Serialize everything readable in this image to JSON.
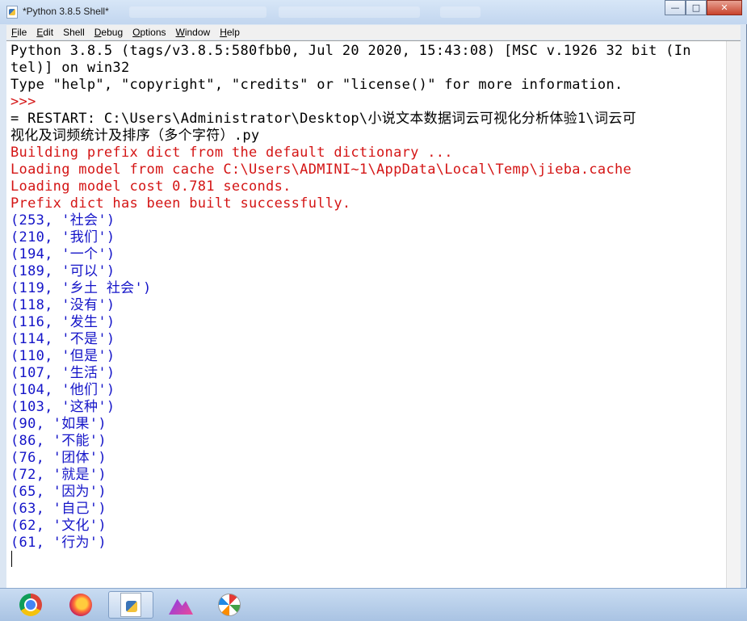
{
  "window": {
    "title": "*Python 3.8.5 Shell*",
    "controls": {
      "minimize": "—",
      "maximize": "□",
      "close": "✕"
    }
  },
  "menu": [
    {
      "underline": "F",
      "rest": "ile"
    },
    {
      "underline": "E",
      "rest": "dit"
    },
    {
      "underline": "",
      "rest": "Shell"
    },
    {
      "underline": "D",
      "rest": "ebug"
    },
    {
      "underline": "O",
      "rest": "ptions"
    },
    {
      "underline": "W",
      "rest": "indow"
    },
    {
      "underline": "H",
      "rest": "elp"
    }
  ],
  "shell": {
    "banner_1": "Python 3.8.5 (tags/v3.8.5:580fbb0, Jul 20 2020, 15:43:08) [MSC v.1926 32 bit (In",
    "banner_2": "tel)] on win32",
    "banner_3": "Type \"help\", \"copyright\", \"credits\" or \"license()\" for more information.",
    "prompt": ">>>",
    "restart_1": "= RESTART: C:\\Users\\Administrator\\Desktop\\小说文本数据词云可视化分析体验1\\词云可",
    "restart_2": "视化及词频统计及排序（多个字符）.py",
    "stderr": [
      "Building prefix dict from the default dictionary ...",
      "Loading model from cache C:\\Users\\ADMINI~1\\AppData\\Local\\Temp\\jieba.cache",
      "Loading model cost 0.781 seconds.",
      "Prefix dict has been built successfully."
    ],
    "results": [
      "(253, '社会')",
      "(210, '我们')",
      "(194, '一个')",
      "(189, '可以')",
      "(119, '乡土 社会')",
      "(118, '没有')",
      "(116, '发生')",
      "(114, '不是')",
      "(110, '但是')",
      "(107, '生活')",
      "(104, '他们')",
      "(103, '这种')",
      "(90, '如果')",
      "(86, '不能')",
      "(76, '团体')",
      "(72, '就是')",
      "(65, '因为')",
      "(63, '自己')",
      "(62, '文化')",
      "(61, '行为')"
    ]
  },
  "colors": {
    "stdout": "#000000",
    "stderr": "#d41515",
    "result": "#1414c8"
  },
  "taskbar": {
    "apps": [
      "chrome-icon",
      "firefox-icon",
      "idle-icon",
      "mountain-app-icon",
      "pinwheel-app-icon"
    ],
    "active_app": "idle-icon"
  }
}
